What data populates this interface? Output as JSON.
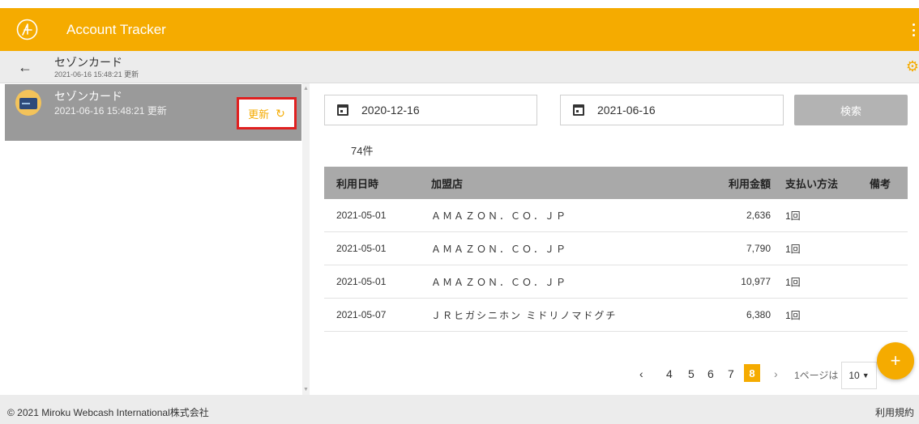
{
  "appbar": {
    "title": "Account Tracker",
    "accent": "#f5ab00"
  },
  "subbar": {
    "title": "セゾンカード",
    "updated": "2021-06-16 15:48:21 更新"
  },
  "sidebar": {
    "account": {
      "name": "セゾンカード",
      "updated": "2021-06-16 15:48:21 更新",
      "update_label": "更新"
    }
  },
  "search": {
    "from_date": "2020-12-16",
    "to_date": "2021-06-16",
    "button_label": "検索"
  },
  "result_count": "74件",
  "table": {
    "headers": {
      "date": "利用日時",
      "shop": "加盟店",
      "amount": "利用金額",
      "method": "支払い方法",
      "note": "備考"
    },
    "rows": [
      {
        "date": "2021-05-01",
        "shop": "ＡＭＡＺＯＮ．ＣＯ．ＪＰ",
        "amount": "2,636",
        "method": "1回",
        "note": ""
      },
      {
        "date": "2021-05-01",
        "shop": "ＡＭＡＺＯＮ．ＣＯ．ＪＰ",
        "amount": "7,790",
        "method": "1回",
        "note": ""
      },
      {
        "date": "2021-05-01",
        "shop": "ＡＭＡＺＯＮ．ＣＯ．ＪＰ",
        "amount": "10,977",
        "method": "1回",
        "note": ""
      },
      {
        "date": "2021-05-07",
        "shop": "ＪＲヒガシニホン ミドリノマドグチ",
        "amount": "6,380",
        "method": "1回",
        "note": ""
      }
    ]
  },
  "pagination": {
    "prev": "‹",
    "pages": [
      "4",
      "5",
      "6",
      "7"
    ],
    "current": "8",
    "next": "›",
    "per_page_label": "1ページは",
    "per_page_value": "10"
  },
  "footer": {
    "copyright": "© 2021 Miroku Webcash International株式会社",
    "terms": "利用規約"
  }
}
